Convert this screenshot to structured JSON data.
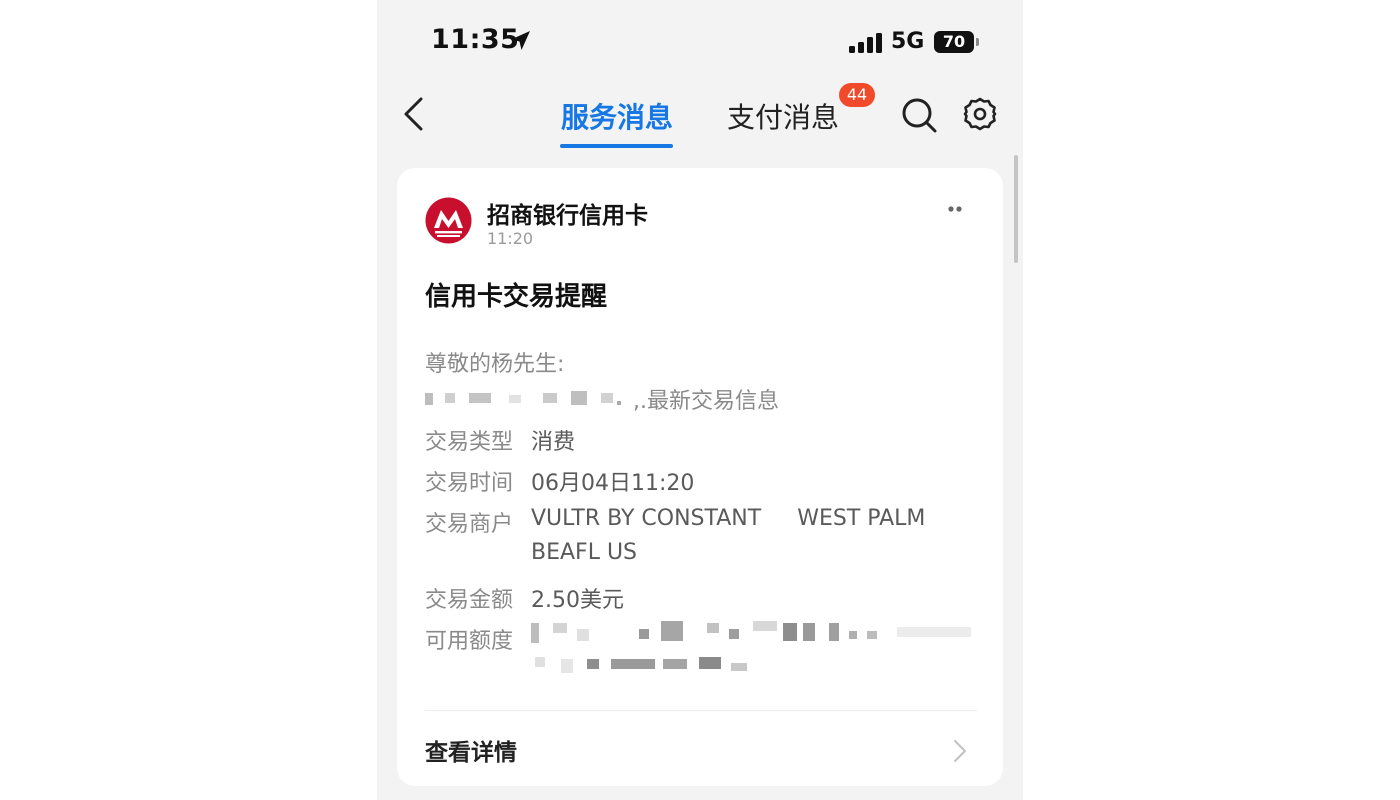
{
  "status_bar": {
    "time": "11:35",
    "network": "5G",
    "battery": "70",
    "location_icon": "location-arrow-icon",
    "signal_icon": "cellular-signal-icon"
  },
  "nav": {
    "back_icon": "chevron-left-icon",
    "tabs": [
      {
        "label": "服务消息",
        "active": true
      },
      {
        "label": "支付消息",
        "active": false,
        "badge": "44"
      }
    ],
    "search_icon": "search-icon",
    "settings_icon": "gear-icon",
    "accent_color": "#1677e5",
    "badge_color": "#f04a2a"
  },
  "message": {
    "sender": "招商银行信用卡",
    "time": "11:20",
    "logo_icon": "cmb-bank-logo",
    "logo_color": "#c8102e",
    "more_icon": "more-dots-icon",
    "title": "信用卡交易提醒",
    "greeting": "尊敬的杨先生:",
    "intro_suffix": ",.最新交易信息",
    "rows": [
      {
        "label": "交易类型",
        "value": "消费"
      },
      {
        "label": "交易时间",
        "value": "06月04日11:20"
      },
      {
        "label": "交易商户",
        "value_line1_a": "VULTR BY CONSTANT",
        "value_line1_b": "WEST PALM",
        "value_line2": "BEAFL US"
      },
      {
        "label": "交易金额",
        "value": "2.50美元"
      },
      {
        "label": "可用额度",
        "value": ""
      }
    ],
    "detail_label": "查看详情",
    "detail_icon": "chevron-right-icon"
  }
}
